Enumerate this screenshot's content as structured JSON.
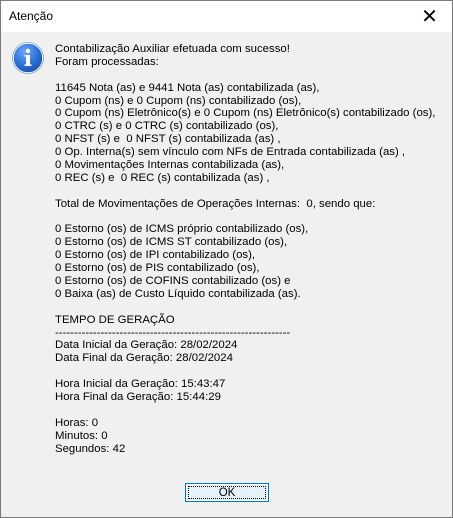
{
  "window": {
    "title": "Atenção",
    "close_glyph": "✕"
  },
  "icon": "info-icon",
  "message": {
    "lines": [
      "Contabilização Auxiliar efetuada com sucesso!",
      "Foram processadas:",
      "",
      "11645 Nota (as) e 9441 Nota (as) contabilizada (as),",
      "0 Cupom (ns) e 0 Cupom (ns) contabilizado (os),",
      "0 Cupom (ns) Eletrônico(s) e 0 Cupom (ns) Eletrônico(s) contabilizado (os),",
      "0 CTRC (s) e 0 CTRC (s) contabilizado (os),",
      "0 NFST (s) e  0 NFST (s) contabilizada (as) ,",
      "0 Op. Interna(s) sem vínculo com NFs de Entrada contabilizada (as) ,",
      "0 Movimentações Internas contabilizada (as),",
      "0 REC (s) e  0 REC (s) contabilizada (as) ,",
      "",
      "Total de Movimentações de Operações Internas:  0, sendo que:",
      "",
      "0 Estorno (os) de ICMS próprio contabilizado (os),",
      "0 Estorno (os) de ICMS ST contabilizado (os),",
      "0 Estorno (os) de IPI contabilizado (os),",
      "0 Estorno (os) de PIS contabilizado (os),",
      "0 Estorno (os) de COFINS contabilizado (os) e",
      "0 Baixa (as) de Custo Líquido contabilizada (as).",
      "",
      "TEMPO DE GERAÇÃO",
      "--------------------------------------------------------------",
      "Data Inicial da Geração: 28/02/2024",
      "Data Final da Geração: 28/02/2024",
      "",
      "Hora Inicial da Geração: 15:43:47",
      "Hora Final da Geração: 15:44:29",
      "",
      "Horas: 0",
      "Minutos: 0",
      "Segundos: 42"
    ]
  },
  "buttons": {
    "ok_label": "OK"
  },
  "colors": {
    "dialog_bg": "#f0f0f0",
    "titlebar_bg": "#ffffff",
    "button_border": "#0078d7",
    "button_bg": "#e5f1fb",
    "icon_blue": "#1f5fbf"
  }
}
